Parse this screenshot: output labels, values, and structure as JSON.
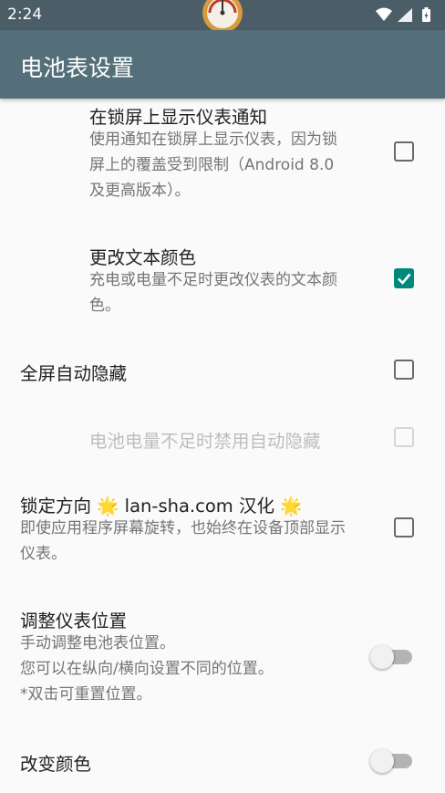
{
  "status_bar": {
    "time": "2:24",
    "icons": [
      "wifi-icon",
      "signal-icon",
      "battery-charging-icon"
    ]
  },
  "app_bar": {
    "title": "电池表设置"
  },
  "settings": [
    {
      "title": "在锁屏上显示仪表通知",
      "summary": [
        "使用通知在锁屏上显示仪表，因为锁",
        "屏上的覆盖受到限制（Android 8.0",
        "及更高版本）。"
      ],
      "control": "checkbox",
      "checked": false,
      "enabled": true
    },
    {
      "title": "更改文本颜色",
      "summary": [
        "充电或电量不足时更改仪表的文本颜",
        "色。"
      ],
      "control": "checkbox",
      "checked": true,
      "enabled": true
    },
    {
      "title": "全屏自动隐藏",
      "control": "checkbox",
      "checked": false,
      "enabled": true
    },
    {
      "title": "电池电量不足时禁用自动隐藏",
      "control": "checkbox",
      "checked": false,
      "enabled": false
    },
    {
      "title": "锁定方向 🌟 lan-sha.com 汉化 🌟",
      "summary": [
        "即使应用程序屏幕旋转，也始终在设备顶部显示",
        "仪表。"
      ],
      "control": "checkbox",
      "checked": false,
      "enabled": true
    },
    {
      "title": "调整仪表位置",
      "summary": [
        "手动调整电池表位置。",
        "您可以在纵向/横向设置不同的位置。",
        "*双击可重置位置。"
      ],
      "control": "switch",
      "checked": false,
      "enabled": true
    },
    {
      "title": "改变颜色",
      "control": "switch",
      "checked": false,
      "enabled": true
    }
  ],
  "colors": {
    "status_bar": "#4b5d67",
    "app_bar": "#546e7a",
    "accent": "#00897b"
  }
}
